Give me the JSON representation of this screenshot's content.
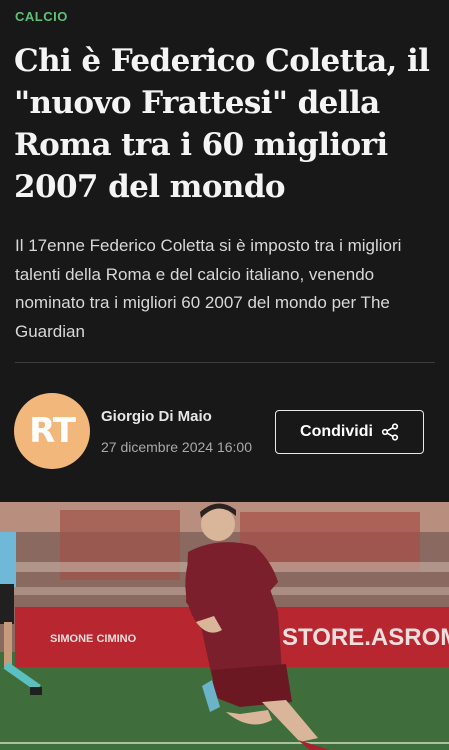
{
  "article": {
    "section": "CALCIO",
    "headline": "Chi è Federico Coletta, il \"nuovo Frattesi\" della Roma tra i 60 migliori 2007 del mondo",
    "subtitle": "Il 17enne Federico Coletta si è imposto tra i migliori talenti della Roma e del calcio italiano, venendo nominato tra i migliori 60 2007 del mondo per The Guardian"
  },
  "byline": {
    "avatar_initials": "RT",
    "author": "Giorgio Di Maio",
    "date": "27 dicembre 2024 16:00",
    "share_label": "Condividi",
    "share_icon": "share-icon"
  },
  "hero_image": {
    "banner_text": "STORE.ASROMA.CO",
    "sponsor_text": "SIMONE CIMINO"
  },
  "colors": {
    "background": "#181818",
    "section_tag": "#5fbf7a",
    "avatar_bg": "#f2b77a",
    "jersey": "#7a1f2b"
  }
}
